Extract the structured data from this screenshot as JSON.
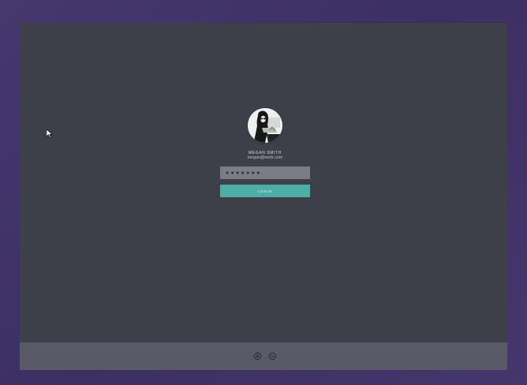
{
  "login": {
    "name": "MEGAN SMITH",
    "email": "megan@work.com",
    "password_mask": "●●●●●●●",
    "login_label": "LOGIN"
  },
  "taskbar": {
    "icons": [
      "settings-icon",
      "power-icon"
    ]
  },
  "colors": {
    "background": "#3e4049",
    "bezel": "#3f3268",
    "field": "#7b7d86",
    "accent": "#4daea5",
    "taskbar": "#5a5a67"
  }
}
